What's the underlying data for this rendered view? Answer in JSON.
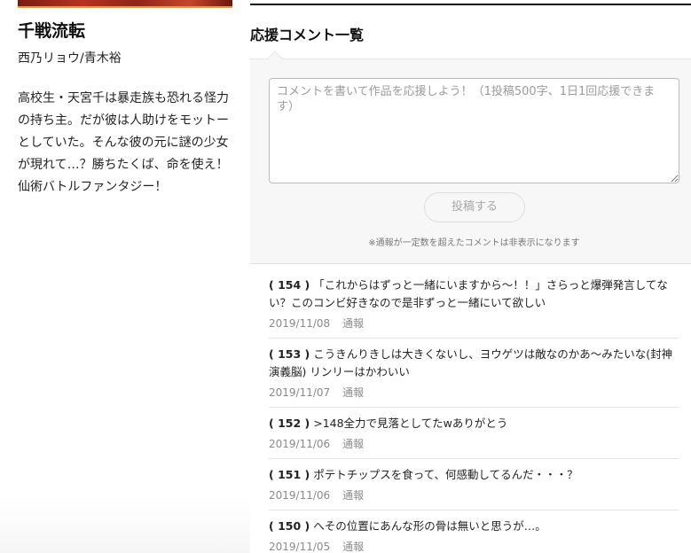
{
  "work": {
    "title": "千戦流転",
    "author": "西乃リョウ/青木裕",
    "synopsis": "高校生・天宮千は暴走族も恐れる怪力の持ち主。だが彼は人助けをモットーとしていた。そんな彼の元に謎の少女が現れて…？勝ちたくば、命を使え！仙術バトルファンタジー！"
  },
  "comments_section": {
    "title": "応援コメント一覧",
    "placeholder": "コメントを書いて作品を応援しよう！（1投稿500字、1日1回応援できます）",
    "post_button": "投稿する",
    "note": "※通報が一定数を超えたコメントは非表示になります"
  },
  "comments": [
    {
      "num": "( 154 )",
      "text": "「これからはずっと一緒にいますから〜！！」さらっと爆弾発言してない？このコンビ好きなので是非ずっと一緒にいて欲しい",
      "date": "2019/11/08",
      "report": "通報"
    },
    {
      "num": "( 153 )",
      "text": "こうきんりきしは大きくないし、ヨウゲツは敵なのかあ〜みたいな(封神演義脳) リンリーはかわいい",
      "date": "2019/11/07",
      "report": "通報"
    },
    {
      "num": "( 152 )",
      "text": ">148全力で見落としてたwありがとう",
      "date": "2019/11/06",
      "report": "通報"
    },
    {
      "num": "( 151 )",
      "text": "ポテトチップスを食って、何感動してるんだ・・・？",
      "date": "2019/11/06",
      "report": "通報"
    },
    {
      "num": "( 150 )",
      "text": "へその位置にあんな形の骨は無いと思うが…。",
      "date": "2019/11/05",
      "report": "通報"
    }
  ],
  "colors": {
    "accent_dark": "#111111",
    "form_bg": "#f7f7f7",
    "meta_gray": "#8a8a8a"
  }
}
